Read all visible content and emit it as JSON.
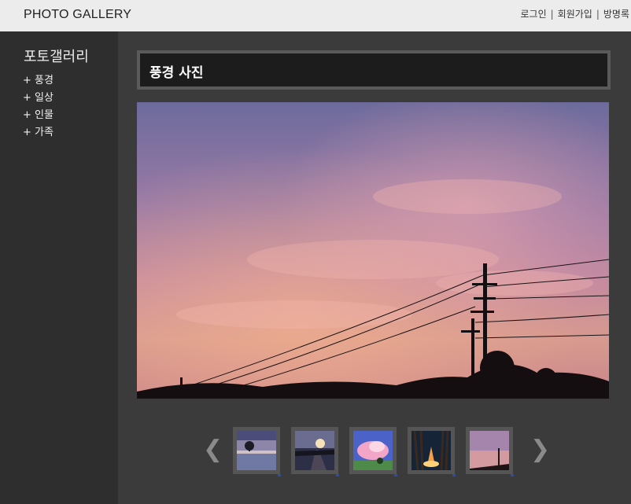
{
  "header": {
    "brand": "PHOTO GALLERY",
    "links": [
      "로그인",
      "회원가입",
      "방명록"
    ]
  },
  "sidebar": {
    "title": "포토갤러리",
    "items": [
      "+ 풍경",
      "+ 일상",
      "+ 인물",
      "+ 가족"
    ]
  },
  "main": {
    "title": "풍경 사진"
  },
  "thumbnails": {
    "prev_icon": "❮",
    "next_icon": "❯",
    "items": [
      {
        "name": "lake-reflection-thumb"
      },
      {
        "name": "railway-sunset-thumb"
      },
      {
        "name": "pink-cloud-thumb"
      },
      {
        "name": "campfire-night-thumb"
      },
      {
        "name": "pink-sky-thumb"
      }
    ]
  }
}
